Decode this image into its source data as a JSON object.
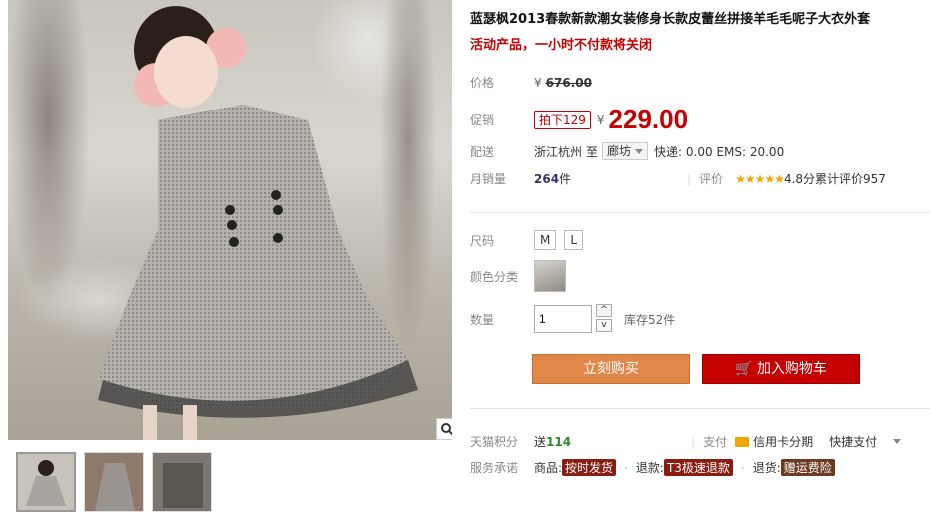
{
  "product": {
    "title": "蓝瑟枫2013春款新款潮女装修身长款皮蕾丝拼接羊毛毛呢子大衣外套",
    "promo_note": "活动产品，一小时不付款将关闭"
  },
  "price": {
    "label": "价格",
    "currency": "¥",
    "original": "676.00"
  },
  "promo": {
    "label": "促销",
    "tag": "拍下129",
    "currency": "¥",
    "price": "229.00"
  },
  "shipping": {
    "label": "配送",
    "from": "浙江杭州",
    "to_word": "至",
    "destination": "廊坊",
    "fees": "快递: 0.00 EMS: 20.00"
  },
  "sales": {
    "label": "月销量",
    "count": "264",
    "unit": "件",
    "review_label": "评价",
    "stars": "★★★★★",
    "rating_text": "4.8分累计评价957"
  },
  "options": {
    "size_label": "尺码",
    "sizes": [
      "M",
      "L"
    ],
    "color_label": "颜色分类"
  },
  "quantity": {
    "label": "数量",
    "value": "1",
    "up": "^",
    "down": "v",
    "stock": "库存52件"
  },
  "actions": {
    "buy_now": "立刻购买",
    "add_to_cart": "加入购物车"
  },
  "points": {
    "label": "天猫积分",
    "prefix": "送",
    "value": "114",
    "pay_label": "支付",
    "credit": "信用卡分期",
    "quick_pay": "快捷支付"
  },
  "service": {
    "label": "服务承诺",
    "goods_label": "商品:",
    "goods_tag": "按时发货",
    "refund_label": "退款:",
    "refund_tag": "T3极速退款",
    "return_label": "退货:",
    "return_tag": "赠运费险"
  },
  "colors": {
    "accent_red": "#c40000",
    "buy_orange": "#e0884a"
  }
}
